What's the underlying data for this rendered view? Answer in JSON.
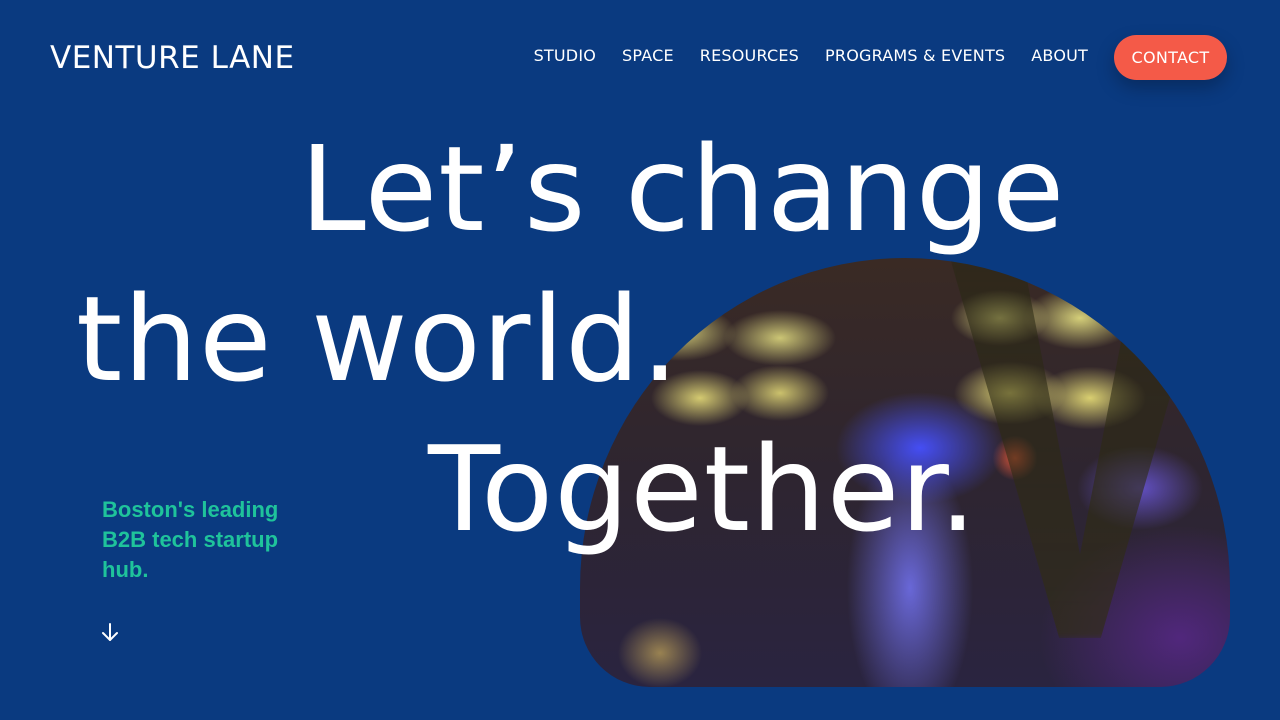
{
  "header": {
    "logo_text": "VENTURE LANE",
    "nav": [
      {
        "label": "STUDIO"
      },
      {
        "label": "SPACE"
      },
      {
        "label": "RESOURCES"
      },
      {
        "label": "PROGRAMS & EVENTS"
      },
      {
        "label": "ABOUT"
      }
    ],
    "contact_label": "CONTACT"
  },
  "hero": {
    "headline_line1": "Let’s change",
    "headline_line2": "the world.",
    "headline_line3": "Together.",
    "tagline": "Boston's leading B2B tech startup hub.",
    "scroll_icon": "arrow-down-icon"
  },
  "colors": {
    "background": "#0a3a80",
    "accent": "#f45a48",
    "tagline": "#1fc39b",
    "text": "#ffffff"
  }
}
